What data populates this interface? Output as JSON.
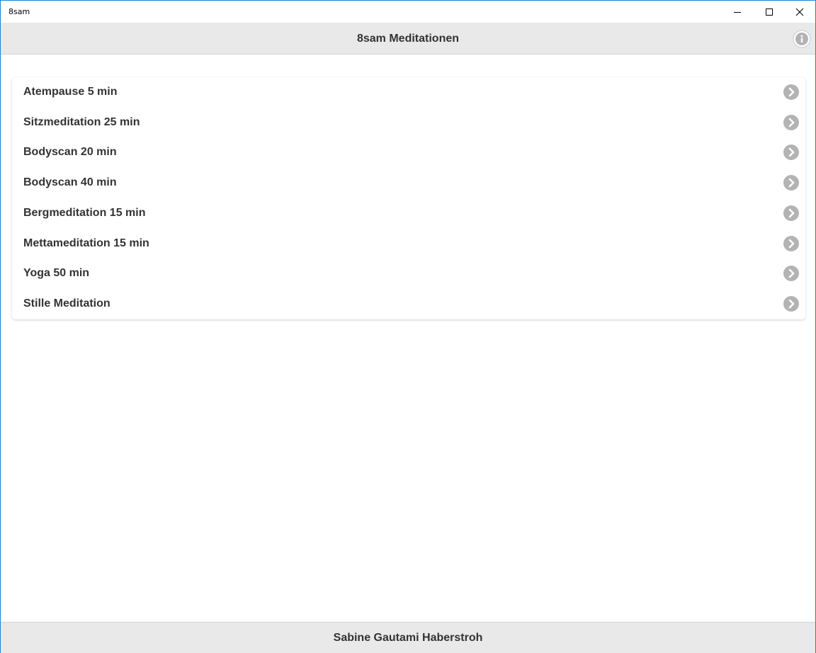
{
  "window": {
    "title": "8sam"
  },
  "header": {
    "title": "8sam Meditationen",
    "info_icon": "info-icon"
  },
  "meditations": [
    {
      "label": "Atempause 5 min"
    },
    {
      "label": "Sitzmeditation 25 min"
    },
    {
      "label": "Bodyscan 20 min"
    },
    {
      "label": "Bodyscan 40 min"
    },
    {
      "label": "Bergmeditation 15 min"
    },
    {
      "label": "Mettameditation 15 min"
    },
    {
      "label": "Yoga 50 min"
    },
    {
      "label": "Stille Meditation"
    }
  ],
  "footer": {
    "text": "Sabine Gautami Haberstroh"
  },
  "colors": {
    "header_bg": "#e9e9e9",
    "icon_gray": "#b3b3b3",
    "text": "#333333",
    "window_border": "#1883d7"
  }
}
